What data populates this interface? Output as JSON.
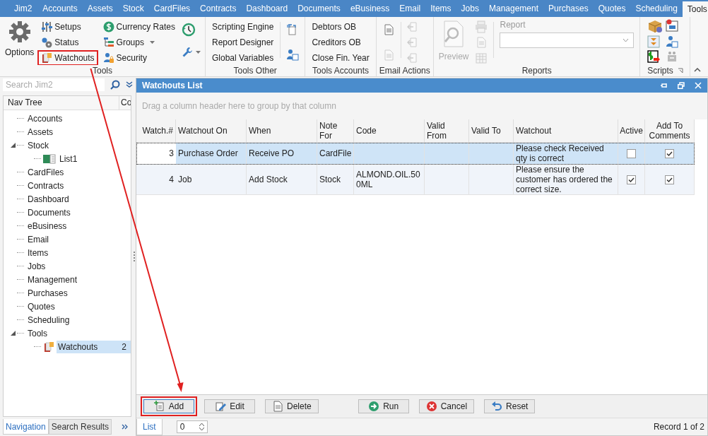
{
  "menu_bar": {
    "app_button": "Jim2",
    "tabs": [
      {
        "label": "Accounts",
        "selected": false
      },
      {
        "label": "Assets",
        "selected": false
      },
      {
        "label": "Stock",
        "selected": false
      },
      {
        "label": "CardFiles",
        "selected": false
      },
      {
        "label": "Contracts",
        "selected": false
      },
      {
        "label": "Dashboard",
        "selected": false
      },
      {
        "label": "Documents",
        "selected": false
      },
      {
        "label": "eBusiness",
        "selected": false
      },
      {
        "label": "Email",
        "selected": false
      },
      {
        "label": "Items",
        "selected": false
      },
      {
        "label": "Jobs",
        "selected": false
      },
      {
        "label": "Management",
        "selected": false
      },
      {
        "label": "Purchases",
        "selected": false
      },
      {
        "label": "Quotes",
        "selected": false
      },
      {
        "label": "Scheduling",
        "selected": false
      },
      {
        "label": "Tools",
        "selected": true
      }
    ]
  },
  "ribbon": {
    "tools": {
      "title": "Tools",
      "options": "Options",
      "items": [
        {
          "label": "Setups",
          "highlighted": false,
          "dropdown": false
        },
        {
          "label": "Status",
          "highlighted": false,
          "dropdown": false
        },
        {
          "label": "Watchouts",
          "highlighted": true,
          "dropdown": false
        },
        {
          "label": "Currency Rates",
          "highlighted": false,
          "dropdown": false
        },
        {
          "label": "Groups",
          "highlighted": false,
          "dropdown": true
        },
        {
          "label": "Security",
          "highlighted": false,
          "dropdown": false
        }
      ]
    },
    "tools_other": {
      "title": "Tools Other",
      "items": [
        "Scripting Engine",
        "Report Designer",
        "Global Variables"
      ]
    },
    "tools_accounts": {
      "title": "Tools Accounts",
      "items": [
        "Debtors OB",
        "Creditors OB",
        "Close Fin. Year"
      ]
    },
    "email_actions": {
      "title": "Email Actions"
    },
    "reports": {
      "title": "Reports",
      "preview": {
        "label": "Preview",
        "disabled": true
      },
      "report_field": {
        "label": "Report",
        "disabled": true
      }
    },
    "scripts": {
      "title": "Scripts"
    }
  },
  "navigation": {
    "search": {
      "placeholder": "Search Jim2"
    },
    "tree": {
      "columns": [
        "Nav Tree",
        "Co"
      ],
      "items": [
        {
          "label": "Accounts",
          "selected": false
        },
        {
          "label": "Assets",
          "selected": false
        },
        {
          "label": "Stock",
          "selected": false,
          "expanded": true,
          "children": [
            {
              "label": "List1",
              "selected": false
            }
          ]
        },
        {
          "label": "CardFiles",
          "selected": false
        },
        {
          "label": "Contracts",
          "selected": false
        },
        {
          "label": "Dashboard",
          "selected": false
        },
        {
          "label": "Documents",
          "selected": false
        },
        {
          "label": "eBusiness",
          "selected": false
        },
        {
          "label": "Email",
          "selected": false
        },
        {
          "label": "Items",
          "selected": false
        },
        {
          "label": "Jobs",
          "selected": false
        },
        {
          "label": "Management",
          "selected": false
        },
        {
          "label": "Purchases",
          "selected": false
        },
        {
          "label": "Quotes",
          "selected": false
        },
        {
          "label": "Scheduling",
          "selected": false
        },
        {
          "label": "Tools",
          "selected": false,
          "expanded": true,
          "children": [
            {
              "label": "Watchouts",
              "count": "2",
              "selected": true
            }
          ]
        }
      ]
    },
    "tabs": [
      {
        "label": "Navigation",
        "selected": true
      },
      {
        "label": "Search Results",
        "selected": false
      }
    ]
  },
  "panel": {
    "title": "Watchouts List",
    "group_hint": "Drag a column header here to group by that column",
    "table": {
      "columns": [
        "Watch.#",
        "Watchout On",
        "When",
        "Note For",
        "Code",
        "Valid From",
        "Valid To",
        "Watchout",
        "Active",
        "Add To Comments"
      ],
      "rows": [
        {
          "selected": true,
          "watch_no": "3",
          "watchout_on": "Purchase Order",
          "when": "Receive PO",
          "note_for": "CardFile",
          "watchout": "Please check Received qty is correct",
          "active": false,
          "add_to_comments": true
        },
        {
          "selected": false,
          "watch_no": "4",
          "watchout_on": "Job",
          "when": "Add Stock",
          "note_for": "Stock",
          "code": "ALMOND.OIL.500ML",
          "watchout": "Please ensure the customer has ordered the correct size.",
          "active": true,
          "add_to_comments": true
        }
      ]
    },
    "buttons": [
      {
        "label": "Add",
        "kind": "add",
        "highlighted": true
      },
      {
        "label": "Edit",
        "kind": "edit",
        "highlighted": false
      },
      {
        "label": "Delete",
        "kind": "delete",
        "highlighted": false
      },
      {
        "label": "Run",
        "kind": "run",
        "highlighted": false
      },
      {
        "label": "Cancel",
        "kind": "cancel",
        "highlighted": false
      },
      {
        "label": "Reset",
        "kind": "reset",
        "highlighted": false
      }
    ],
    "status_bar": {
      "view_tab": "List",
      "spin_value": "0",
      "record": "Record 1 of 2"
    }
  }
}
